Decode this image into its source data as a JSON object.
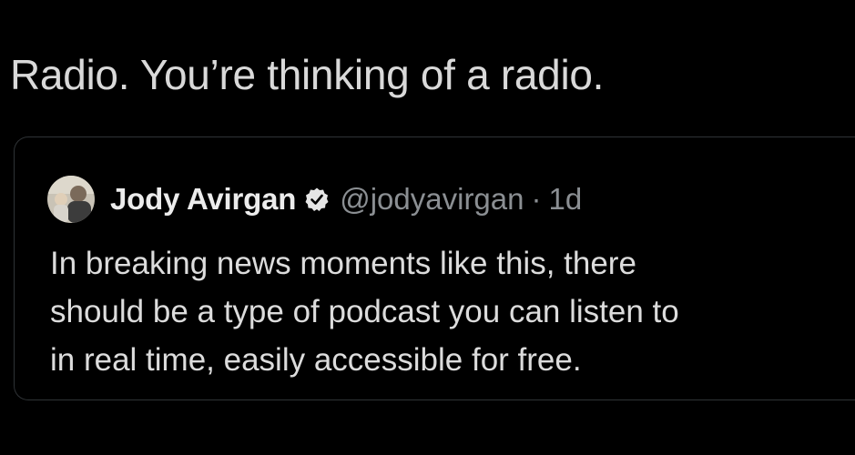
{
  "reply": {
    "text": "Radio. You’re thinking of a radio."
  },
  "quoted_tweet": {
    "author_name": "Jody Avirgan",
    "handle": "@jodyavirgan",
    "separator": "·",
    "time": "1d",
    "verified_icon": "verified-badge-icon",
    "body_lines": [
      "In breaking news moments like this, there",
      "should be a type of podcast you can listen to",
      "in real time, easily accessible for free."
    ]
  },
  "colors": {
    "background": "#000000",
    "primary_text": "#d9d9d9",
    "secondary_text": "#8b8f93",
    "card_border": "#2f3336"
  }
}
